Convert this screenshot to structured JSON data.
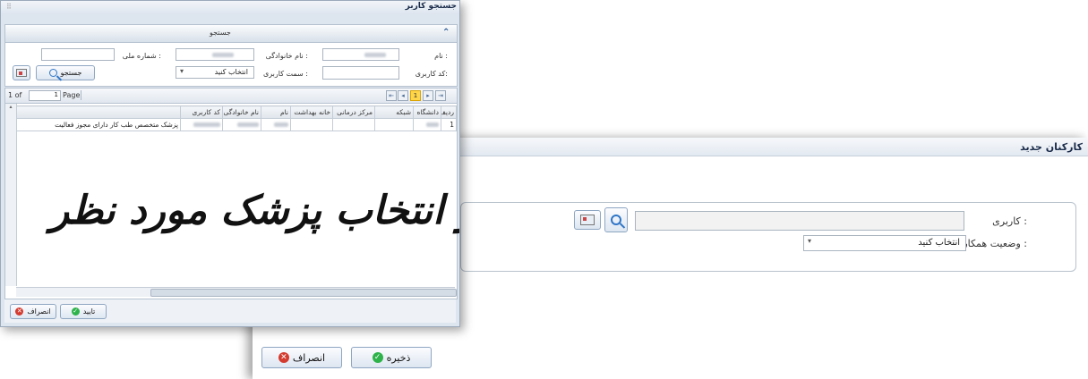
{
  "staff_dialog": {
    "title": "کارکنان جدید",
    "user_label": "کاربری :",
    "cooperation_label": "وضعیت همکاری :",
    "cooperation_value": "انتخاب کنید",
    "save_label": "ذخیره",
    "cancel_label": "انصراف"
  },
  "search_dialog": {
    "title": "جستجو کاربر",
    "section_title": "جستجو",
    "name_label": "نام :",
    "family_label": "نام خانوادگی :",
    "code_label": "شماره ملی :",
    "username_label": "کد کاربری:",
    "role_label": "سمت کاربری :",
    "role_value": "انتخاب کنید",
    "search_button": "جستجو",
    "pager": {
      "of_text": "1 of",
      "page_value": "1",
      "page_label": "Page",
      "current": "1"
    },
    "columns": [
      "ردیف",
      "دانشگاه",
      "شبکه",
      "مرکز درمانی",
      "خانه بهداشت",
      "نام",
      "نام خانوادگی",
      "کد کاربری",
      ""
    ],
    "rows": [
      {
        "index": "1",
        "last": "پزشک متخصص طب کار دارای مجوز فعالیت"
      }
    ],
    "overlay_text": "جست و جو و انتخاب پزشک مورد نظر",
    "ok_label": "تایید",
    "cancel_label": "انصراف"
  }
}
